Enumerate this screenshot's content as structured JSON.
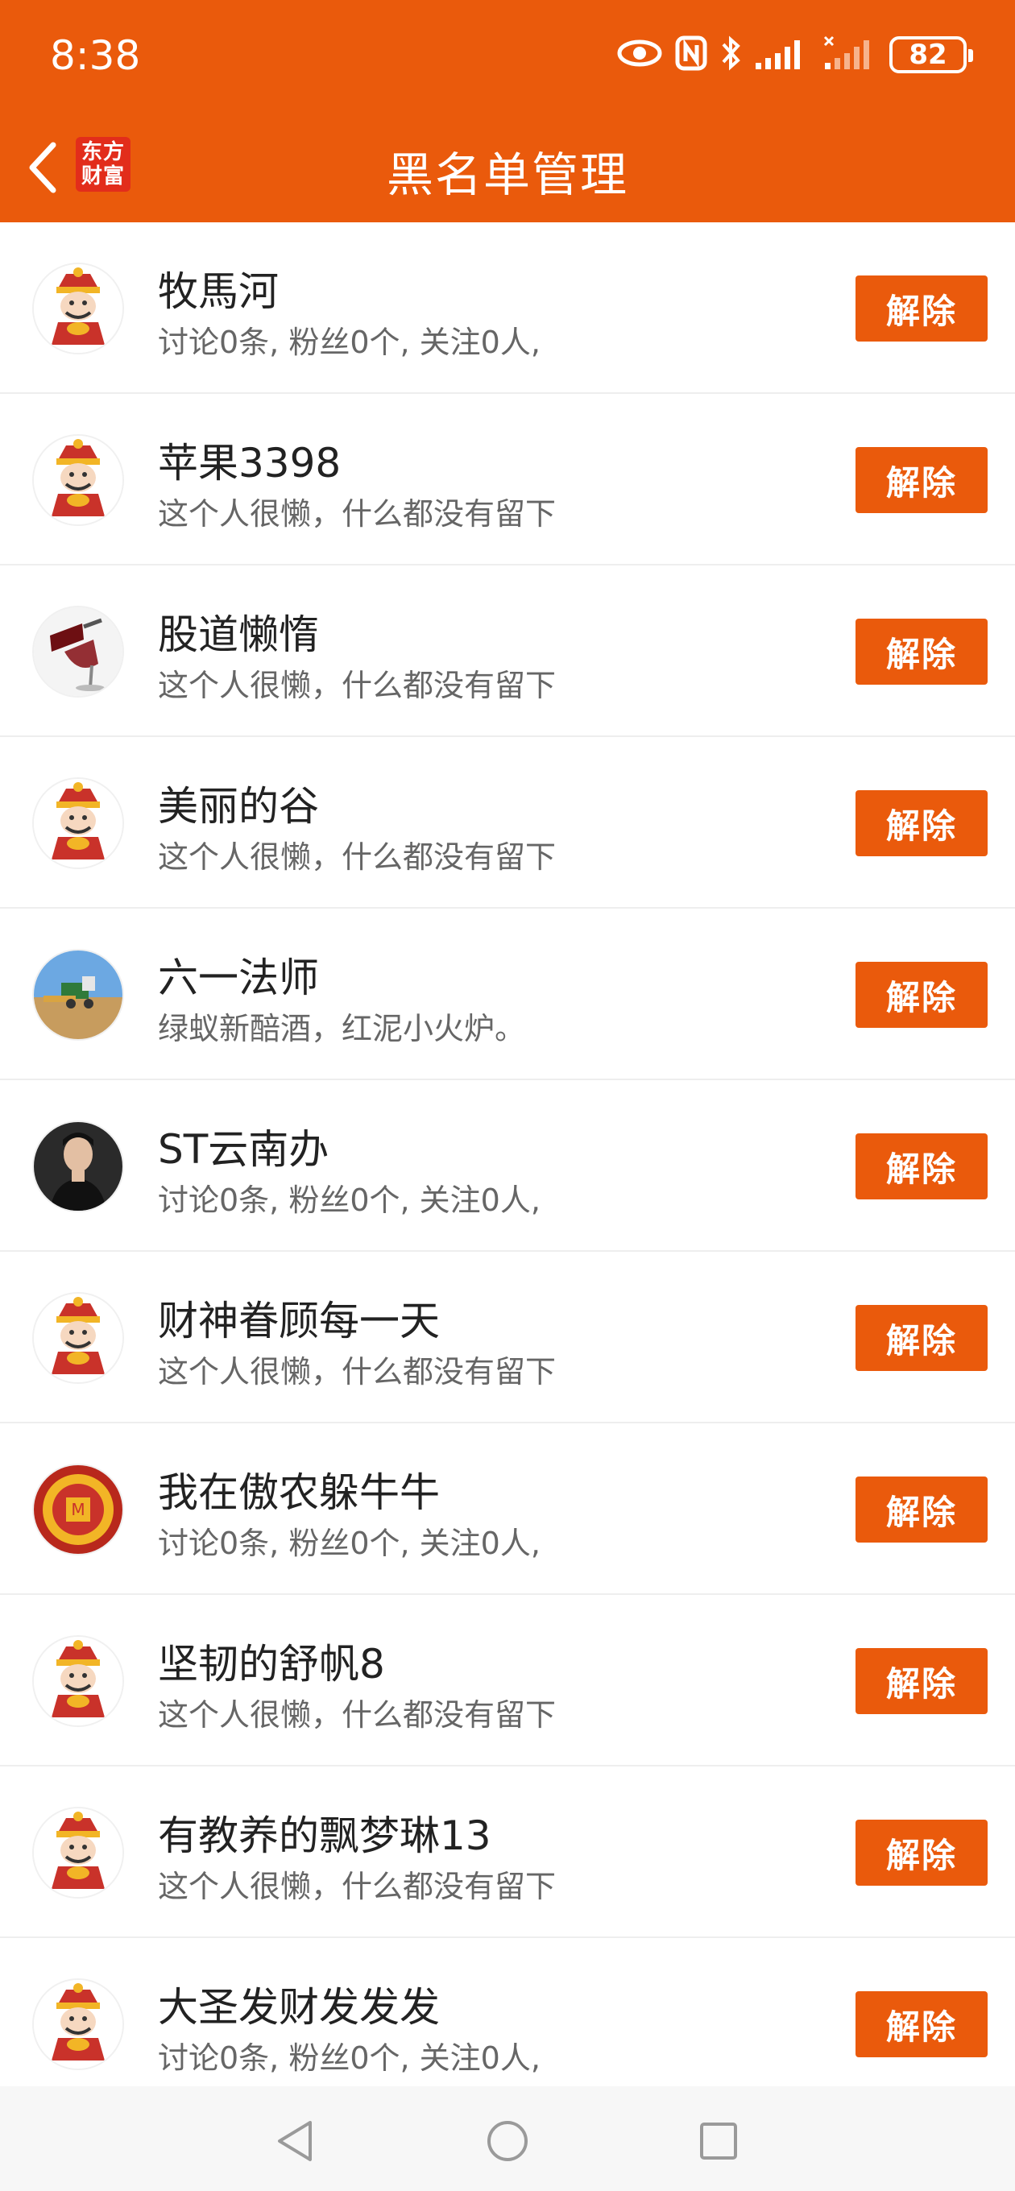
{
  "status": {
    "time": "8:38",
    "battery": "82"
  },
  "header": {
    "title": "黑名单管理",
    "logo_line1": "东方",
    "logo_line2": "财富"
  },
  "remove_label": "解除",
  "users": [
    {
      "name": "牧馬河",
      "desc": "讨论0条, 粉丝0个, 关注0人,",
      "avatar": "caishen-avatar"
    },
    {
      "name": "苹果3398",
      "desc": "这个人很懒，什么都没有留下",
      "avatar": "caishen-avatar"
    },
    {
      "name": "股道懒惰",
      "desc": "这个人很懒，什么都没有留下",
      "avatar": "wine-glass-avatar"
    },
    {
      "name": "美丽的谷",
      "desc": "这个人很懒，什么都没有留下",
      "avatar": "caishen-avatar"
    },
    {
      "name": "六一法师",
      "desc": "绿蚁新醅酒，红泥小火炉。",
      "avatar": "harvester-avatar"
    },
    {
      "name": "ST云南办",
      "desc": "讨论0条, 粉丝0个, 关注0人,",
      "avatar": "portrait-avatar"
    },
    {
      "name": "财神眷顾每一天",
      "desc": "这个人很懒，什么都没有留下",
      "avatar": "caishen-avatar"
    },
    {
      "name": "我在傲农躲牛牛",
      "desc": "讨论0条, 粉丝0个, 关注0人,",
      "avatar": "gold-emblem-avatar"
    },
    {
      "name": "坚韧的舒帆8",
      "desc": "这个人很懒，什么都没有留下",
      "avatar": "caishen-avatar"
    },
    {
      "name": "有教养的飘梦琳13",
      "desc": "这个人很懒，什么都没有留下",
      "avatar": "caishen-avatar"
    },
    {
      "name": "大圣发财发发发",
      "desc": "讨论0条, 粉丝0个, 关注0人,",
      "avatar": "caishen-avatar"
    }
  ],
  "colors": {
    "accent": "#EA5A0C",
    "logo_red": "#E22D1B"
  }
}
